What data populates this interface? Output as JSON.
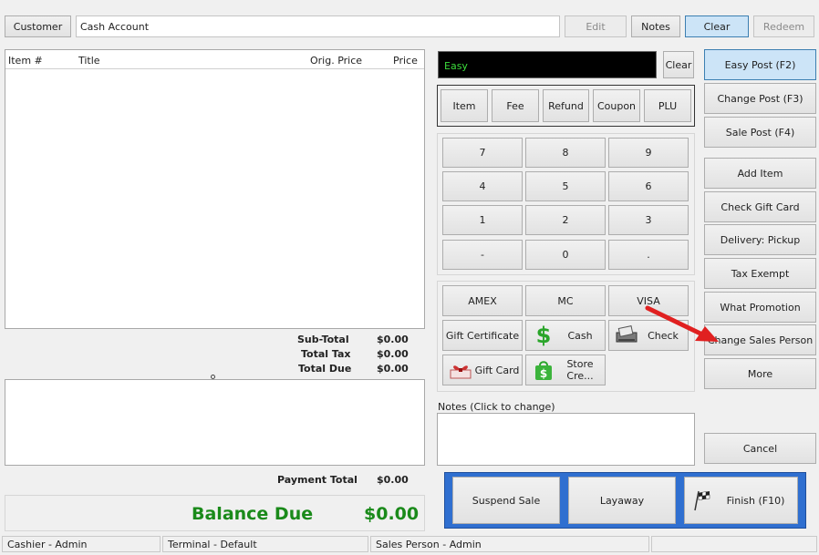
{
  "top": {
    "customer_button": "Customer",
    "customer_field_value": "Cash Account",
    "edit": "Edit",
    "notes": "Notes",
    "clear": "Clear",
    "redeem": "Redeem"
  },
  "items_table": {
    "columns": [
      "Item #",
      "Title",
      "Orig. Price",
      "Price"
    ]
  },
  "totals": {
    "subtotal_label": "Sub-Total",
    "subtotal_value": "$0.00",
    "tax_label": "Total Tax",
    "tax_value": "$0.00",
    "due_label": "Total Due",
    "due_value": "$0.00",
    "payment_label": "Payment Total",
    "payment_value": "$0.00",
    "balance_label": "Balance Due",
    "balance_value": "$0.00"
  },
  "entry": {
    "mode_display": "Easy",
    "clear": "Clear"
  },
  "entry_types": [
    "Item",
    "Fee",
    "Refund",
    "Coupon",
    "PLU"
  ],
  "keypad": [
    "7",
    "8",
    "9",
    "4",
    "5",
    "6",
    "1",
    "2",
    "3",
    "-",
    "0",
    "."
  ],
  "tenders": {
    "amex": "AMEX",
    "mc": "MC",
    "visa": "VISA",
    "gift_certificate": "Gift Certificate",
    "cash": "Cash",
    "check": "Check",
    "gift_card": "Gift Card",
    "store_credit": "Store Cre..."
  },
  "notes": {
    "label": "Notes (Click to change)"
  },
  "actions": {
    "easy_post": "Easy Post (F2)",
    "change_post": "Change Post (F3)",
    "sale_post": "Sale Post (F4)",
    "add_item": "Add Item",
    "check_gift_card": "Check Gift Card",
    "delivery": "Delivery: Pickup",
    "tax_exempt": "Tax Exempt",
    "what_promotion": "What Promotion",
    "change_sales_person": "Change Sales Person",
    "more": "More",
    "cancel": "Cancel"
  },
  "bottom_actions": {
    "suspend": "Suspend Sale",
    "layaway": "Layaway",
    "finish": "Finish (F10)"
  },
  "status": {
    "cashier": "Cashier - Admin",
    "terminal": "Terminal - Default",
    "sales_person": "Sales Person - Admin",
    "extra": ""
  },
  "colors": {
    "balance_green": "#1a8a1a",
    "display_green": "#3cdc3c",
    "accent_blue": "#2f6fd0",
    "arrow_red": "#e02020"
  }
}
